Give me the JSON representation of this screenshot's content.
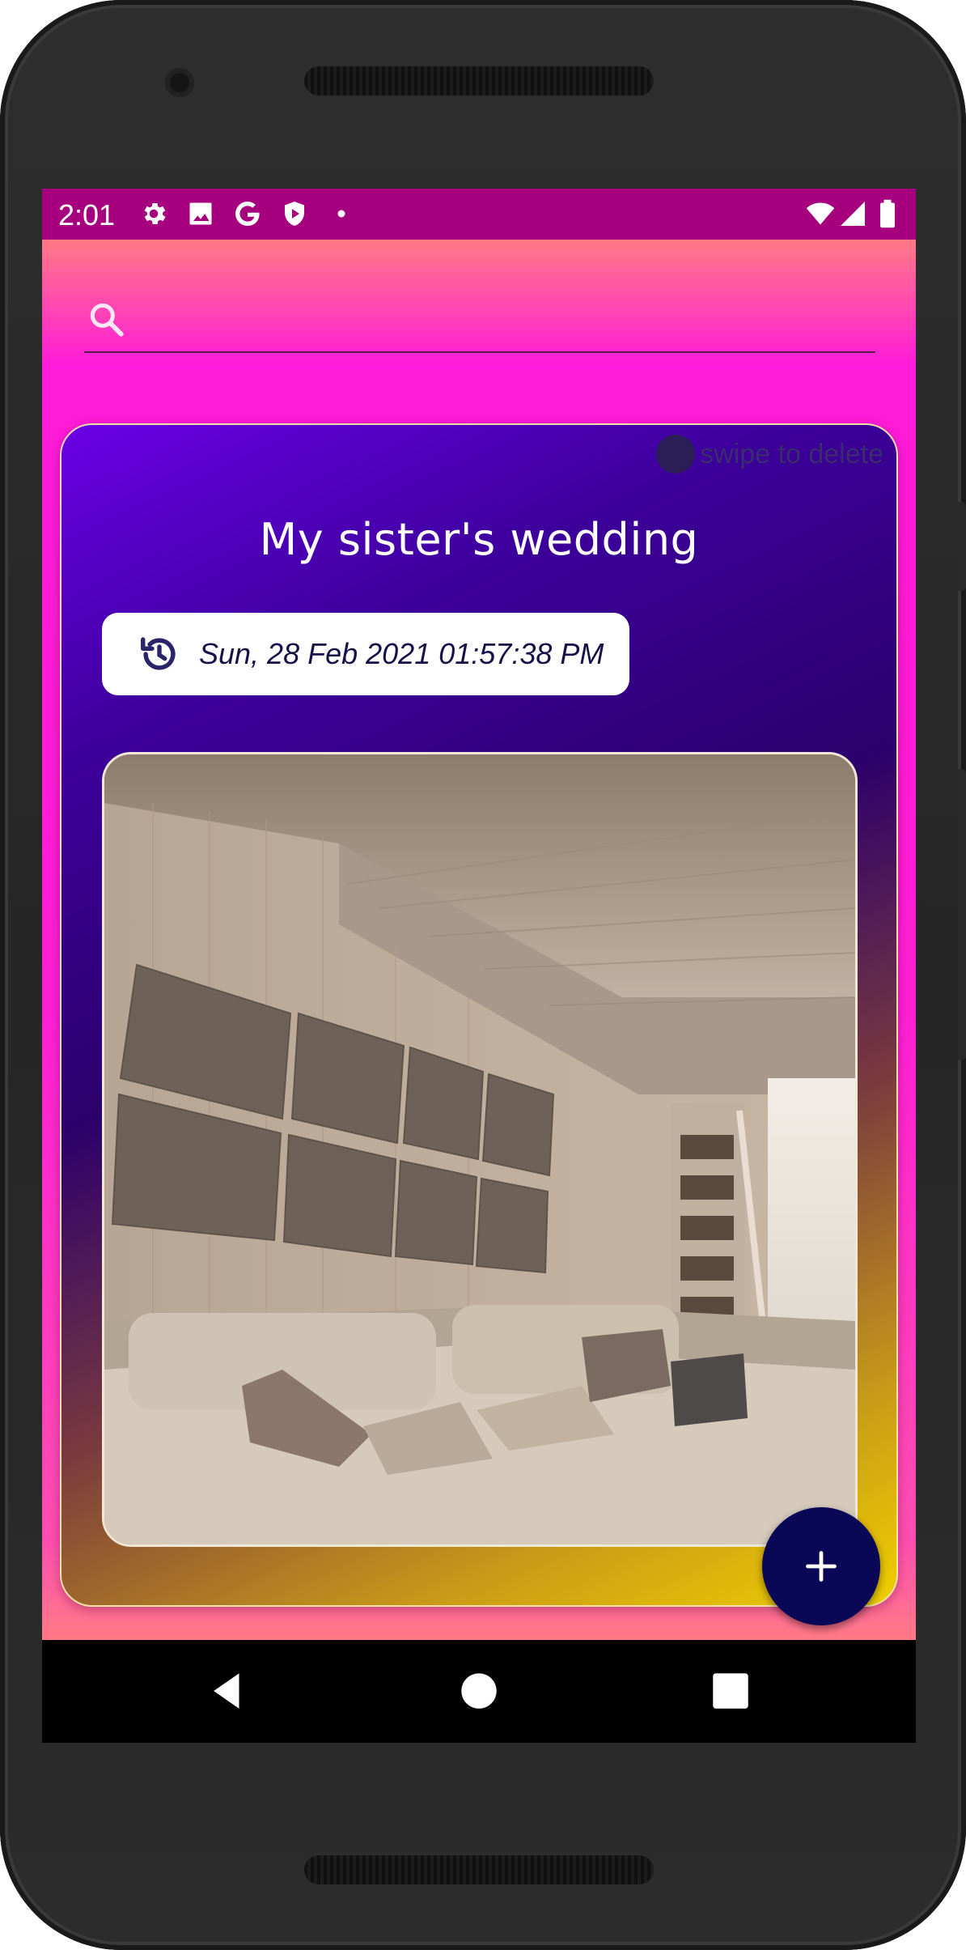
{
  "status_bar": {
    "time": "2:01",
    "left_icons": [
      "gear-icon",
      "image-icon",
      "google-icon",
      "shield-icon",
      "dot-icon"
    ],
    "right_icons": [
      "wifi-icon",
      "signal-icon",
      "battery-icon"
    ],
    "background": "#a6007e"
  },
  "search": {
    "placeholder": "",
    "value": "",
    "icon": "search-icon"
  },
  "card": {
    "swipe_hint": "swipe to delete",
    "title": "My sister's wedding",
    "date": "Sun, 28 Feb 2021 01:57:38 PM",
    "date_icon": "history-icon",
    "image": "living-room-photo"
  },
  "fab": {
    "icon": "plus-icon",
    "color": "#0b0757"
  },
  "nav_bar": {
    "buttons": [
      "back-icon",
      "home-icon",
      "recents-icon"
    ]
  },
  "colors": {
    "accent_pink": "#ff1fd6",
    "card_top": "#6a00e6",
    "card_bottom": "#f0cf00"
  }
}
